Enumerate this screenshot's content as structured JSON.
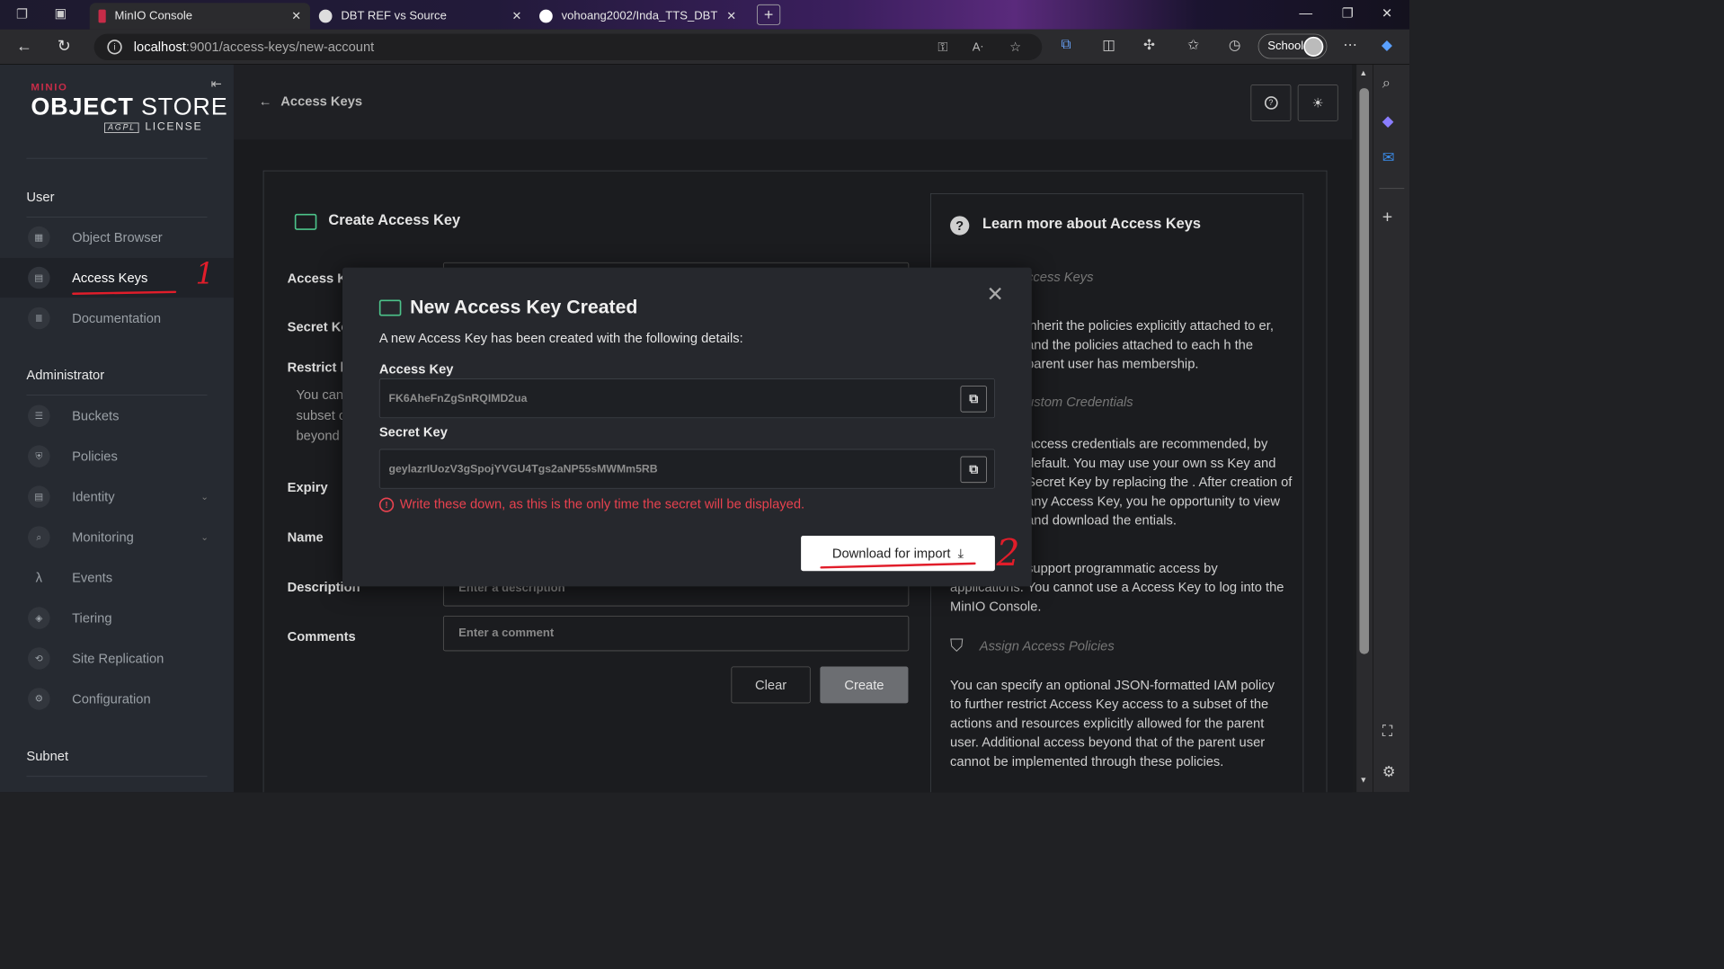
{
  "browser": {
    "tabs": [
      {
        "title": "MinIO Console",
        "active": true
      },
      {
        "title": "DBT REF vs Source",
        "active": false
      },
      {
        "title": "vohoang2002/Inda_TTS_DBT",
        "active": false
      }
    ],
    "url_host": "localhost",
    "url_path": ":9001/access-keys/new-account",
    "profile_label": "School"
  },
  "logo": {
    "brand": "MINIO",
    "product_a": "OBJECT",
    "product_b": "STORE",
    "badge": "AGPL",
    "license": "LICENSE"
  },
  "sidebar": {
    "user_heading": "User",
    "user_items": [
      {
        "label": "Object Browser"
      },
      {
        "label": "Access Keys"
      },
      {
        "label": "Documentation"
      }
    ],
    "admin_heading": "Administrator",
    "admin_items": [
      {
        "label": "Buckets"
      },
      {
        "label": "Policies"
      },
      {
        "label": "Identity"
      },
      {
        "label": "Monitoring"
      },
      {
        "label": "Events"
      },
      {
        "label": "Tiering"
      },
      {
        "label": "Site Replication"
      },
      {
        "label": "Configuration"
      }
    ],
    "subnet_heading": "Subnet"
  },
  "annotations": {
    "mark1": "1",
    "mark2": "2",
    "color": "#e11d2a"
  },
  "topbar": {
    "back_label": "Access Keys"
  },
  "form": {
    "title": "Create Access Key",
    "access_key_label": "Access K",
    "secret_key_label": "Secret Ke",
    "restrict_label": "Restrict b",
    "restrict_text_1": "You can",
    "restrict_text_2": "subset o",
    "restrict_text_3": "beyond",
    "expiry_label": "Expiry",
    "name_label": "Name",
    "description_label": "Description",
    "description_placeholder": "Enter a description",
    "comments_label": "Comments",
    "comments_placeholder": "Enter a comment",
    "clear_label": "Clear",
    "create_label": "Create"
  },
  "help": {
    "title": "Learn more about Access Keys",
    "sub1": "ccess Keys",
    "p1": "inherit the policies explicitly attached to er, and the policies attached to each h the parent user has membership.",
    "sub2": "ustom Credentials",
    "p2": "access credentials are recommended, by default. You may use your own ss Key and Secret Key by replacing the . After creation of any Access Key, you he opportunity to view and download the entials.",
    "p3": "support programmatic access by applications. You cannot use a Access Key to log into the MinIO Console.",
    "sub3": "Assign Access Policies",
    "p4": "You can specify an optional JSON-formatted IAM policy to further restrict Access Key access to a subset of the actions and resources explicitly allowed for the parent user. Additional access beyond that of the parent user cannot be implemented through these policies."
  },
  "modal": {
    "title": "New Access Key Created",
    "description": "A new Access Key has been created with the following details:",
    "access_key_label": "Access Key",
    "access_key_value": "FK6AheFnZgSnRQIMD2ua",
    "secret_key_label": "Secret Key",
    "secret_key_value": "geylazrIUozV3gSpojYVGU4Tgs2aNP55sMWMm5RB",
    "warning": "Write these down, as this is the only time the secret will be displayed.",
    "download_label": "Download for import"
  },
  "colors": {
    "accent_green": "#4cc38a",
    "warning_red": "#e8424f",
    "brand_red": "#c72c48"
  }
}
